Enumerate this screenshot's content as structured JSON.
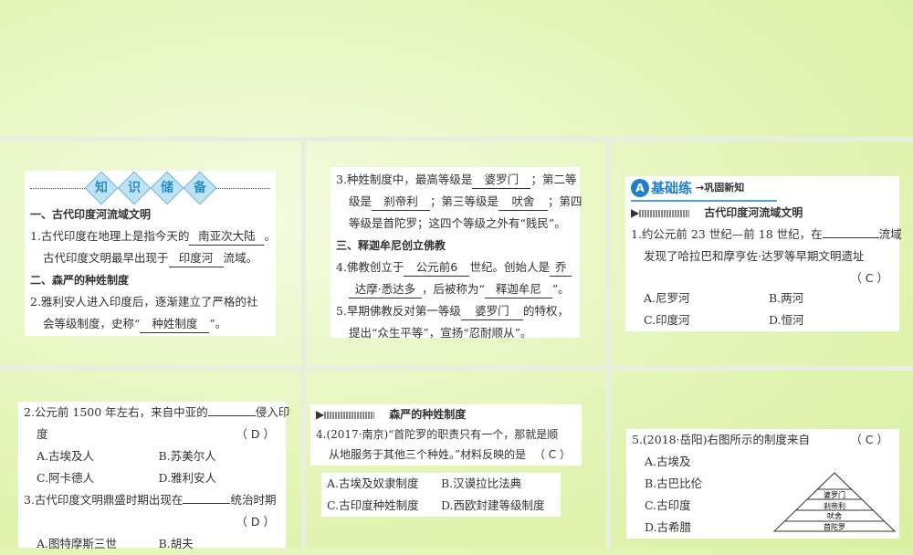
{
  "panel1": {
    "badge": [
      "知",
      "识",
      "储",
      "备"
    ],
    "sec1": "一、古代印度河流域文明",
    "q1a": "1.古代印度在地理上是指今天的",
    "a1a": "南亚次大陆",
    "q1b": "。",
    "q1c": "古代印度文明最早出现于",
    "a1b": "印度河",
    "q1d": "流域。",
    "sec2": "二、森严的种姓制度",
    "q2a": "2.雅利安人进入印度后，逐渐建立了严格的社",
    "q2b": "会等级制度，史称“",
    "a2": "种姓制度",
    "q2c": "”。"
  },
  "panel2": {
    "q3a": "3.种姓制度中，最高等级是",
    "a3a": "婆罗门",
    "q3b": "；第二等",
    "q3c": "级是",
    "a3b": "刹帝利",
    "q3d": "；第三等级是",
    "a3c": "吠舍",
    "q3e": "；第四",
    "q3f": "等级是首陀罗；这四个等级之外有“贱民”。",
    "sec3": "三、释迦牟尼创立佛教",
    "q4a": "4.佛教创立于",
    "a4a": "公元前6",
    "q4b": "世纪。创始人是",
    "a4b1": "乔",
    "a4b2": "达摩·悉达多",
    "q4c": "，后被称为“",
    "a4c": "释迦牟尼",
    "q4d": "”。",
    "q5a": "5.早期佛教反对第一等级",
    "a5": "婆罗门",
    "q5b": "的特权，",
    "q5c": "提出“众生平等”，宣扬“忍耐顺从”。"
  },
  "panel3": {
    "title_letter": "A",
    "title": "基础练",
    "subtitle": "巩固新知",
    "section": "古代印度河流域文明",
    "q1a": "1.约公元前 23 世纪—前 18 世纪，在",
    "q1b": "流域",
    "q1c": "发现了哈拉巴和摩亨佐·达罗等早期文明遗址",
    "answer": "（ C ）",
    "options": [
      "A.尼罗河",
      "B.两河",
      "C.印度河",
      "D.恒河"
    ]
  },
  "panel4": {
    "q2a": "2.公元前 1500 年左右，来自中亚的",
    "q2b": "侵入印",
    "q2c": "度",
    "ans2": "（ D ）",
    "opts2": [
      "A.古埃及人",
      "B.苏美尔人",
      "C.阿卡德人",
      "D.雅利安人"
    ],
    "q3a": "3.古代印度文明鼎盛时期出现在",
    "q3b": "统治时期",
    "ans3": "（ D ）",
    "opts3": [
      "A.图特摩斯三世",
      "B.胡夫"
    ]
  },
  "panel5": {
    "section": "森严的种姓制度",
    "q4a": "4.(2017·南京)“首陀罗的职责只有一个，那就是顺",
    "q4b": "从地服务于其他三个种姓。”材料反映的是",
    "answer": "（ C ）",
    "options": [
      "A.古埃及奴隶制度",
      "B.汉谟拉比法典",
      "C.古印度种姓制度",
      "D.西欧封建等级制度"
    ]
  },
  "panel6": {
    "q5": "5.(2018·岳阳)右图所示的制度来自",
    "answer": "（ C ）",
    "options": [
      "A.古埃及",
      "B.古巴比伦",
      "C.古印度",
      "D.古希腊"
    ],
    "pyramid": [
      "婆罗门",
      "刹帝利",
      "吠舍",
      "首陀罗"
    ]
  }
}
